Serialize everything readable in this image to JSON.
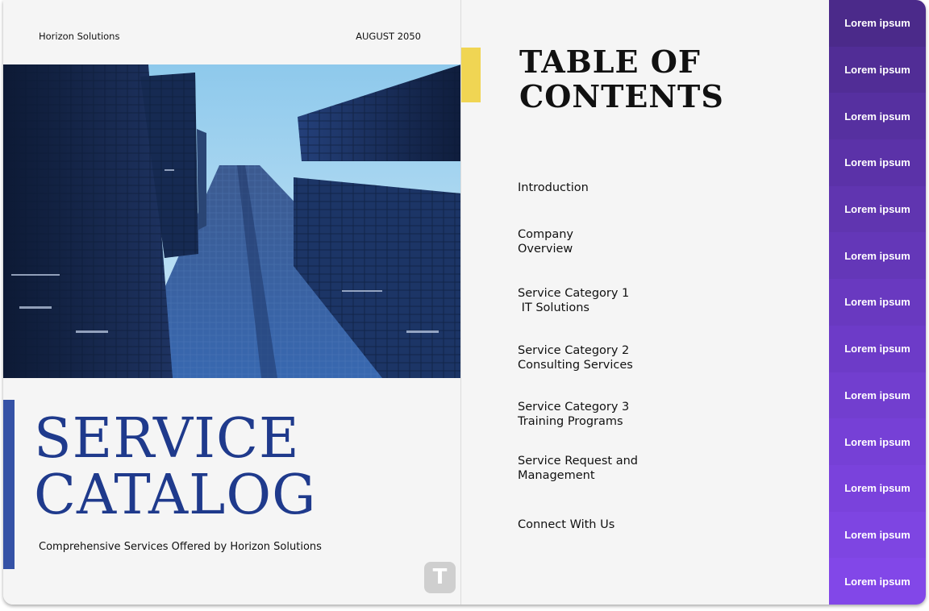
{
  "header": {
    "company": "Horizon Solutions",
    "date": "AUGUST 2050"
  },
  "cover": {
    "title_line1": "SERVICE",
    "title_line2": "CATALOG",
    "subtitle": "Comprehensive Services Offered by Horizon Solutions",
    "logo_letter": "T"
  },
  "toc": {
    "title_line1": "TABLE OF",
    "title_line2": "CONTENTS",
    "items": [
      "Introduction",
      "Company\nOverview",
      "Service Category 1\n IT Solutions",
      "Service Category 2\nConsulting Services",
      "Service Category 3\nTraining Programs",
      "Service Request and\nManagement",
      "Connect With Us"
    ]
  },
  "sidebar": {
    "items": [
      "Lorem ipsum",
      "Lorem ipsum",
      "Lorem ipsum",
      "Lorem ipsum",
      "Lorem ipsum",
      "Lorem ipsum",
      "Lorem ipsum",
      "Lorem ipsum",
      "Lorem ipsum",
      "Lorem ipsum",
      "Lorem ipsum",
      "Lorem ipsum",
      "Lorem ipsum"
    ],
    "colors": [
      "#4b2a8a",
      "#512d96",
      "#5630a0",
      "#5b32a8",
      "#6035b0",
      "#6437b8",
      "#6939c0",
      "#6d3bc8",
      "#723ecf",
      "#7640d6",
      "#7a42dc",
      "#7e45e2",
      "#8247e8"
    ]
  },
  "colors": {
    "title_blue": "#1f3a8c",
    "accent_blue": "#3552a6",
    "accent_yellow": "#f0d553"
  }
}
